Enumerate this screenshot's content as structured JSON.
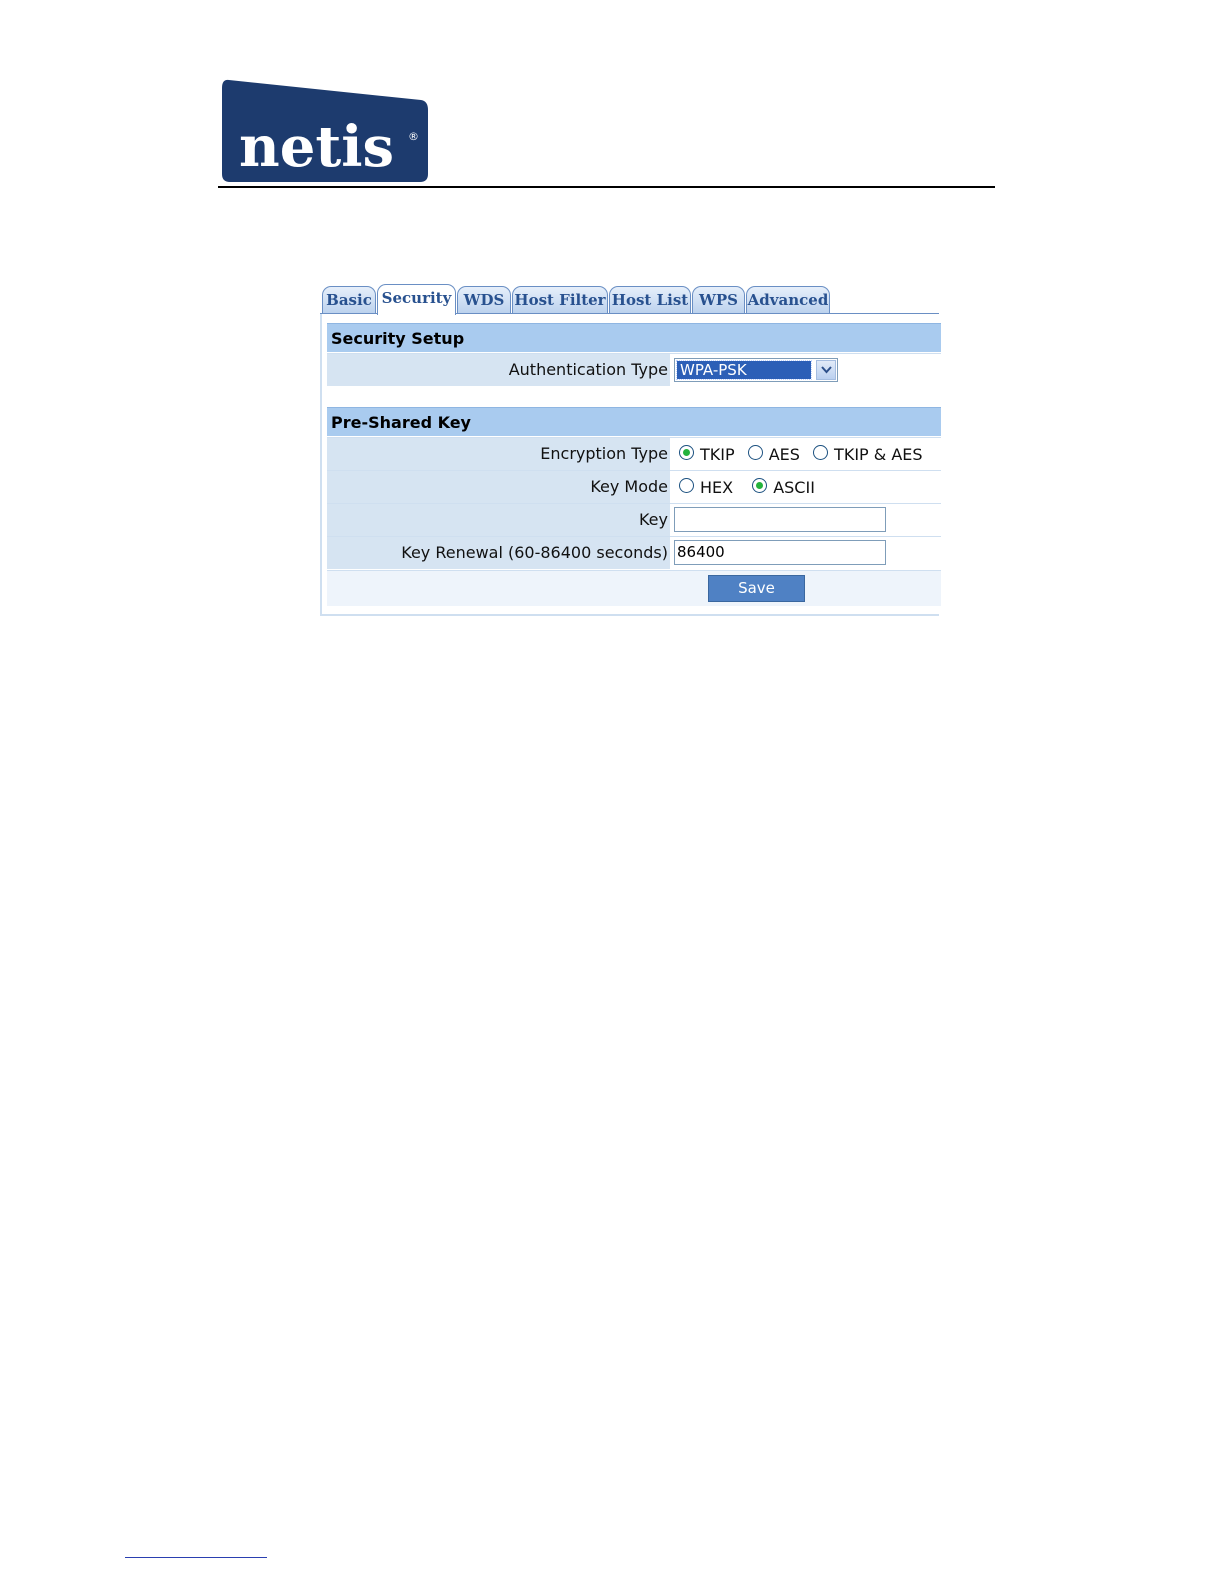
{
  "logo": {
    "text": "netis",
    "registered_mark": "®"
  },
  "tabs": [
    {
      "label": "Basic"
    },
    {
      "label": "Security"
    },
    {
      "label": "WDS"
    },
    {
      "label": "Host Filter"
    },
    {
      "label": "Host List"
    },
    {
      "label": "WPS"
    },
    {
      "label": "Advanced"
    }
  ],
  "active_tab": "Security",
  "security_setup": {
    "header": "Security Setup",
    "auth_label": "Authentication Type",
    "auth_value": "WPA-PSK"
  },
  "psk": {
    "header": "Pre-Shared Key",
    "encryption_label": "Encryption Type",
    "encryption_options": [
      "TKIP",
      "AES",
      "TKIP & AES"
    ],
    "encryption_selected": "TKIP",
    "keymode_label": "Key Mode",
    "keymode_options": [
      "HEX",
      "ASCII"
    ],
    "keymode_selected": "ASCII",
    "key_label": "Key",
    "key_value": "",
    "renewal_label": "Key Renewal (60-86400 seconds)",
    "renewal_value": "86400",
    "save_label": "Save"
  },
  "colors": {
    "header_bg": "#a9cbef",
    "label_bg": "#d6e4f2",
    "button_bg": "#4f81c4",
    "tab_text": "#28518f",
    "logo_bg": "#1d3b6e",
    "radio_selected": "#23b23c"
  }
}
